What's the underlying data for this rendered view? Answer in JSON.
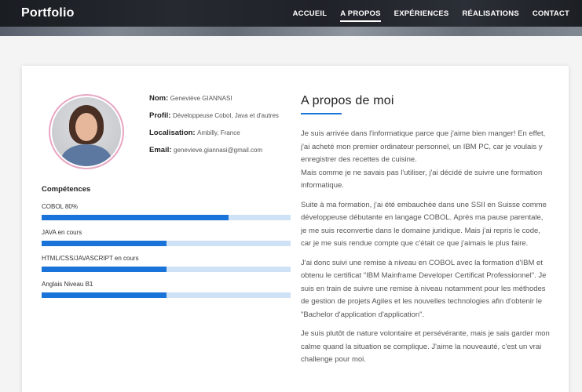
{
  "header": {
    "brand": "Portfolio",
    "nav": [
      {
        "label": "ACCUEIL",
        "active": false
      },
      {
        "label": "A PROPOS",
        "active": true
      },
      {
        "label": "EXPÉRIENCES",
        "active": false
      },
      {
        "label": "RÉALISATIONS",
        "active": false
      },
      {
        "label": "CONTACT",
        "active": false
      }
    ]
  },
  "profile": {
    "name_label": "Nom:",
    "name": "Geneviève GIANNASI",
    "profile_label": "Profil:",
    "profile": "Développeuse Cobol, Java et d'autres",
    "location_label": "Localisation:",
    "location": "Ambilly, France",
    "email_label": "Email:",
    "email": "genevieve.giannasi@gmail.com"
  },
  "skills": {
    "title": "Compétences",
    "items": [
      {
        "label": "COBOL 80%",
        "percent": 75
      },
      {
        "label": "JAVA en cours",
        "percent": 50
      },
      {
        "label": "HTML/CSS/JAVASCRIPT en cours",
        "percent": 50
      },
      {
        "label": "Anglais Niveau B1",
        "percent": 50
      }
    ]
  },
  "about": {
    "title": "A propos de moi",
    "paragraphs": [
      "Je suis arrivée dans l'informatique parce que j'aime bien manger! En effet, j'ai acheté mon premier ordinateur personnel, un IBM PC, car je voulais y enregistrer des recettes de cuisine.\nMais comme je ne savais pas l'utiliser, j'ai décidé de suivre une formation informatique.",
      "Suite à ma formation, j'ai été embauchée dans une SSII en Suisse comme développeuse débutante en langage COBOL. Après ma pause parentale, je me suis reconvertie dans le domaine juridique. Mais j'ai repris le code, car je me suis rendue compte que c'était ce que j'aimais le plus faire.",
      "J'ai donc suivi une remise à niveau en COBOL avec la formation d'IBM et obtenu le certificat \"IBM Mainframe Developer Certificat Professionnel\". Je suis en train de suivre une remise à niveau notamment pour les méthodes de gestion de projets Agiles et les nouvelles technologies afin d'obtenir le \"Bachelor d'application d'application\".",
      "Je suis plutôt de nature volontaire et persévérante, mais je sais garder mon calme quand la situation se complique. J'aime la nouveauté, c'est un vrai challenge pour moi."
    ]
  }
}
